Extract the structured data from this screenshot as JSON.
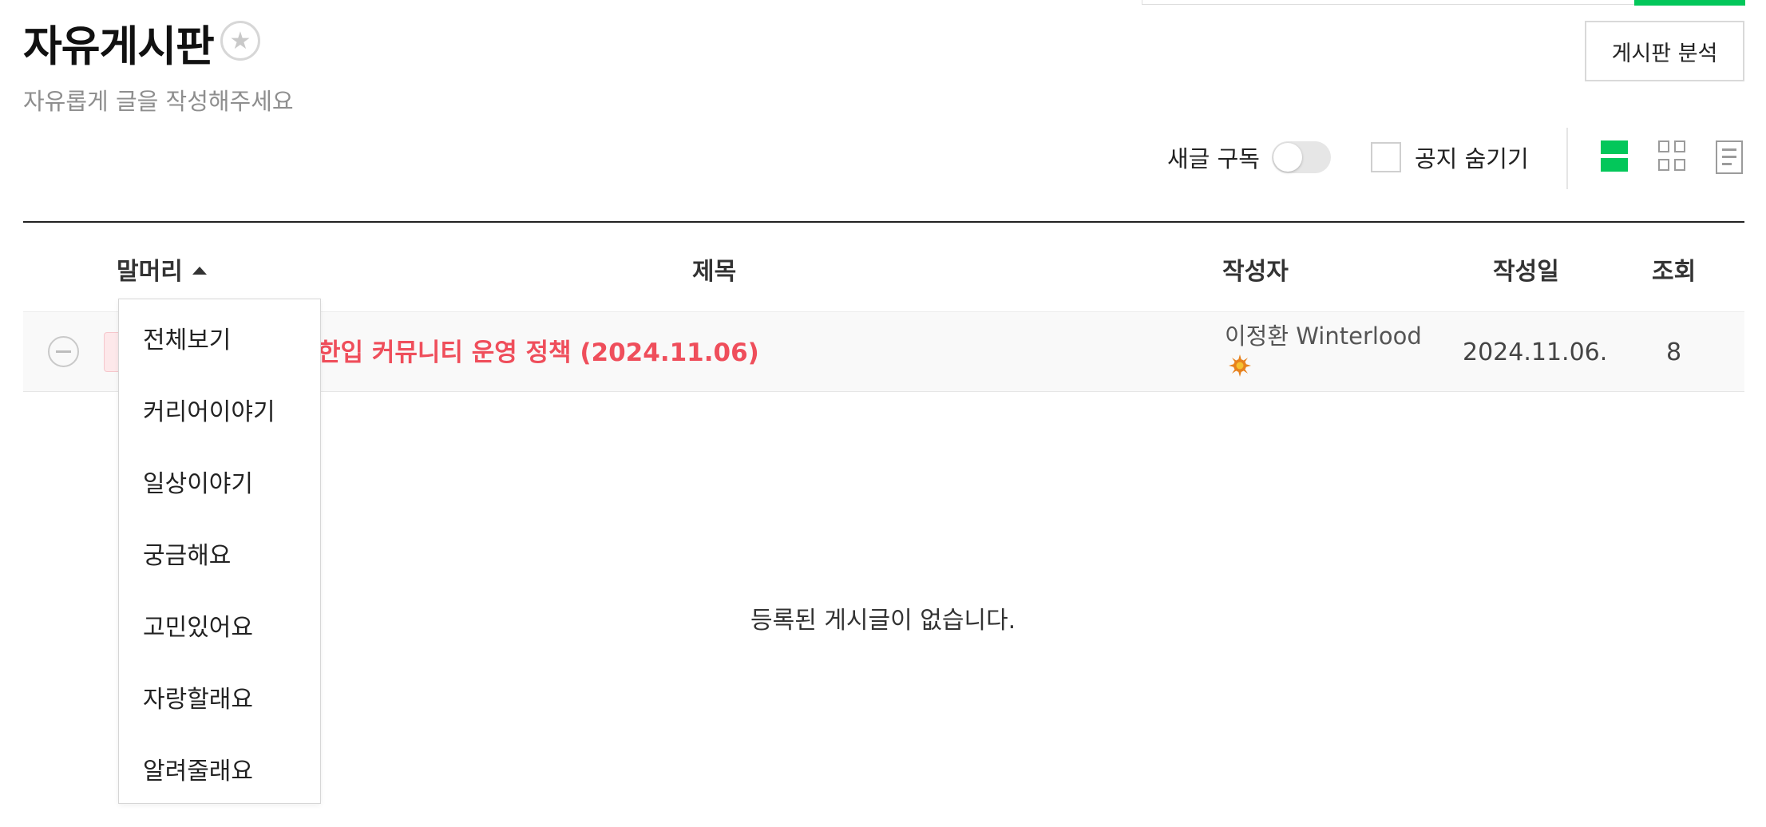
{
  "header": {
    "title": "자유게시판",
    "star_glyph": "★",
    "subtitle": "자유롭게 글을 작성해주세요",
    "analysis_button": "게시판 분석"
  },
  "options": {
    "subscribe_label": "새글 구독",
    "subscribe_on": false,
    "hide_notice_label": "공지 숨기기",
    "hide_notice_checked": false
  },
  "view_modes": {
    "active": "list",
    "items": [
      "list-view-icon",
      "grid-view-icon",
      "text-view-icon"
    ]
  },
  "table": {
    "headers": {
      "category": "말머리",
      "title": "제목",
      "author": "작성자",
      "date": "작성일",
      "views": "조회"
    },
    "notice": {
      "title": "한입 커뮤니티 운영 정책 (2024.11.06)",
      "author": "이정환 Winterlood",
      "date": "2024.11.06.",
      "views": "8"
    },
    "empty_message": "등록된 게시글이 없습니다."
  },
  "category_dropdown": {
    "items": [
      "전체보기",
      "커리어이야기",
      "일상이야기",
      "궁금해요",
      "고민있어요",
      "자랑할래요",
      "알려줄래요"
    ]
  },
  "colors": {
    "accent": "#03c75a",
    "notice_red": "#ef4e5b"
  }
}
